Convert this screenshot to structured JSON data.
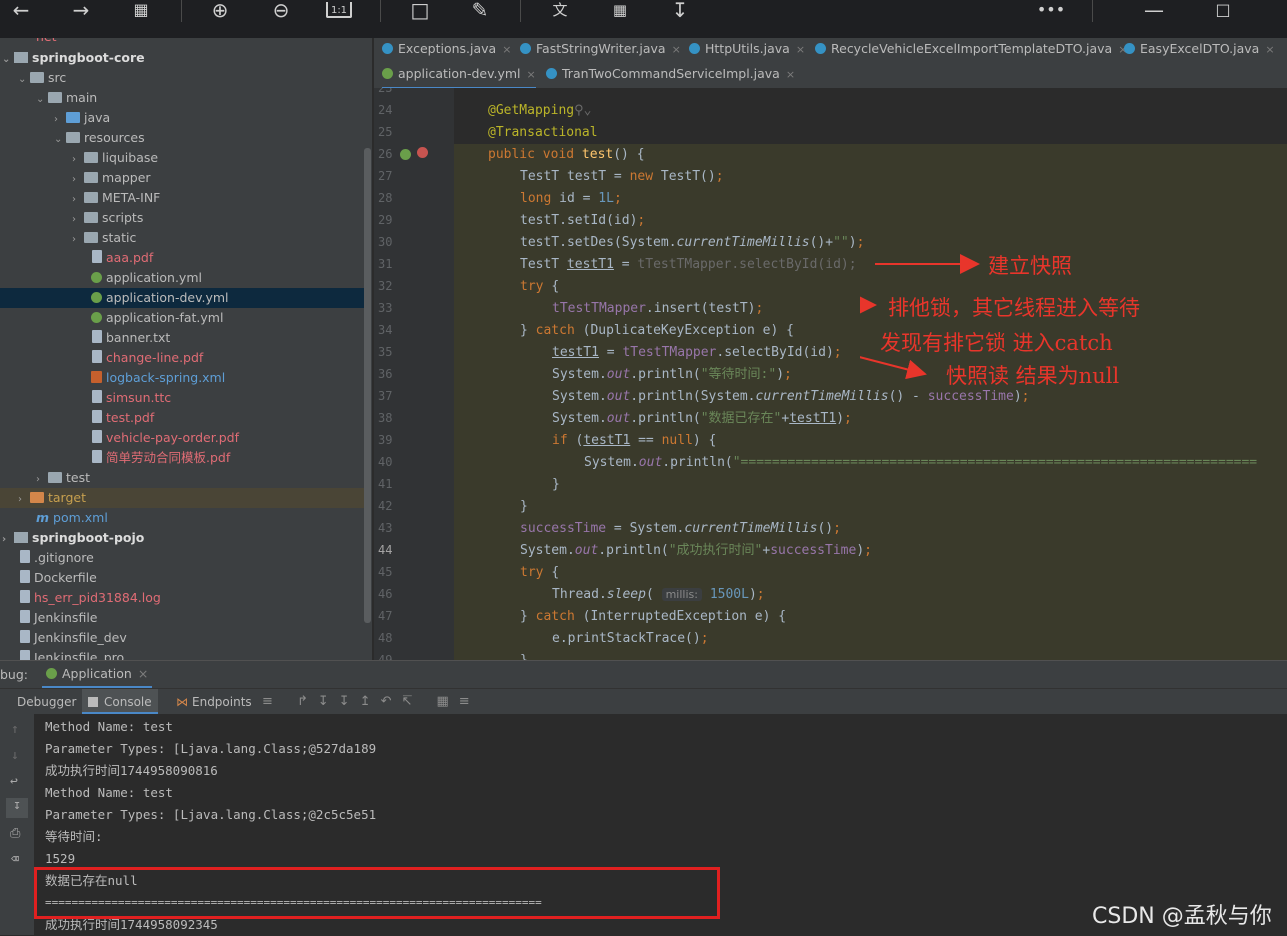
{
  "toolbar": {
    "buttons": [
      "back-icon",
      "forward-icon",
      "grid-icon",
      "zoom-in-icon",
      "zoom-out-icon",
      "actual-size-icon",
      "crop-icon",
      "edit-icon",
      "translate-icon",
      "scan-icon",
      "save-icon",
      "more-icon",
      "minimize-icon",
      "maximize-icon"
    ],
    "more_label": "•••"
  },
  "tree": {
    "items": [
      {
        "label": "net",
        "depth": 0
      },
      {
        "label": "springboot-core"
      },
      {
        "label": "src"
      },
      {
        "label": "main"
      },
      {
        "label": "java"
      },
      {
        "label": "resources"
      },
      {
        "label": "liquibase"
      },
      {
        "label": "mapper"
      },
      {
        "label": "META-INF"
      },
      {
        "label": "scripts"
      },
      {
        "label": "static"
      },
      {
        "label": "aaa.pdf"
      },
      {
        "label": "application.yml"
      },
      {
        "label": "application-dev.yml"
      },
      {
        "label": "application-fat.yml"
      },
      {
        "label": "banner.txt"
      },
      {
        "label": "change-line.pdf"
      },
      {
        "label": "logback-spring.xml"
      },
      {
        "label": "simsun.ttc"
      },
      {
        "label": "test.pdf"
      },
      {
        "label": "vehicle-pay-order.pdf"
      },
      {
        "label": "简单劳动合同模板.pdf"
      },
      {
        "label": "test"
      },
      {
        "label": "target"
      },
      {
        "label": "pom.xml"
      },
      {
        "label": "springboot-pojo"
      },
      {
        "label": ".gitignore"
      },
      {
        "label": "Dockerfile"
      },
      {
        "label": "hs_err_pid31884.log"
      },
      {
        "label": "Jenkinsfile"
      },
      {
        "label": "Jenkinsfile_dev"
      },
      {
        "label": "Jenkinsfile_pro"
      }
    ]
  },
  "tabs": {
    "row1": [
      "Exceptions.java",
      "FastStringWriter.java",
      "HttpUtils.java",
      "RecycleVehicleExcelImportTemplateDTO.java",
      "EasyExcelDTO.java"
    ],
    "row2": [
      "application-dev.yml",
      "TranTwoCommandServiceImpl.java"
    ],
    "close": "×"
  },
  "editor": {
    "line_numbers": [
      "23",
      "24",
      "25",
      "26",
      "27",
      "28",
      "29",
      "30",
      "31",
      "32",
      "33",
      "34",
      "35",
      "36",
      "37",
      "38",
      "39",
      "40",
      "41",
      "42",
      "43",
      "44",
      "45",
      "46",
      "47",
      "48",
      "49"
    ],
    "current_line": "44"
  },
  "annotations": {
    "a1": "建立快照",
    "a2": "排他锁，其它线程进入等待",
    "a3": "发现有排它锁 进入catch",
    "a4": "快照读 结果为null"
  },
  "debug": {
    "label": "bug:",
    "session": "Application",
    "tabs": [
      "Debugger",
      "Console",
      "Endpoints"
    ]
  },
  "console": {
    "lines": [
      "Method Name: test",
      "Parameter Types: [Ljava.lang.Class;@527da189",
      "成功执行时间1744958090816",
      "Method Name: test",
      "Parameter Types: [Ljava.lang.Class;@2c5c5e51",
      "等待时间:",
      "1529",
      "数据已存在null",
      "===========================================================================",
      "成功执行时间1744958092345"
    ]
  },
  "watermark": "CSDN @孟秋与你"
}
